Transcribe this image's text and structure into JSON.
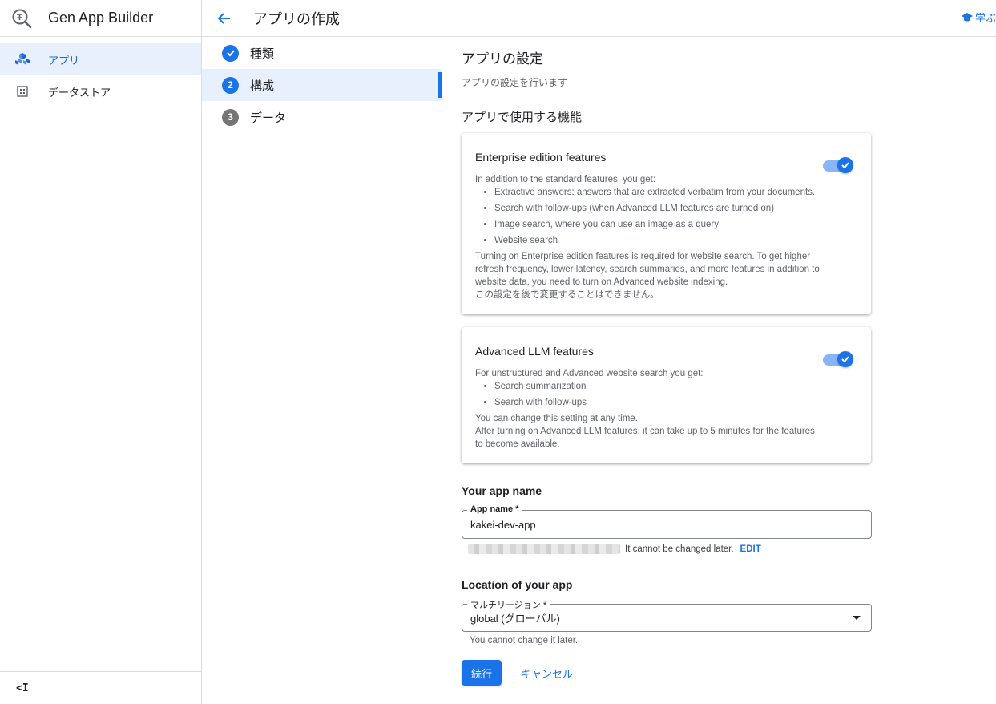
{
  "app": {
    "title": "Gen App Builder"
  },
  "sidebar": {
    "items": [
      {
        "label": "アプリ",
        "icon": "apps-cubes-icon",
        "active": true
      },
      {
        "label": "データストア",
        "icon": "datastore-grid-icon",
        "active": false
      }
    ],
    "collapse_label": "<I"
  },
  "header": {
    "title": "アプリの作成",
    "learn_label": "学ぶ"
  },
  "stepper": {
    "steps": [
      {
        "number": "",
        "label": "種類",
        "status": "done"
      },
      {
        "number": "2",
        "label": "構成",
        "status": "current"
      },
      {
        "number": "3",
        "label": "データ",
        "status": "pending"
      }
    ]
  },
  "main": {
    "section_title": "アプリの設定",
    "section_subtitle": "アプリの設定を行います",
    "features_title": "アプリで使用する機能",
    "enterprise": {
      "title": "Enterprise edition features",
      "intro": "In addition to the standard features, you get:",
      "bullets": [
        "Extractive answers: answers that are extracted verbatim from your documents.",
        "Search with follow-ups (when Advanced LLM features are turned on)",
        "Image search, where you can use an image as a query",
        "Website search"
      ],
      "note": "Turning on Enterprise edition features is required for website search. To get higher refresh frequency, lower latency, search summaries, and more features in addition to website data, you need to turn on Advanced website indexing.",
      "note_ja": "この設定を後で変更することはできません。",
      "enabled": true
    },
    "llm": {
      "title": "Advanced LLM features",
      "intro": "For unstructured and Advanced website search you get:",
      "bullets": [
        "Search summarization",
        "Search with follow-ups"
      ],
      "note1": "You can change this setting at any time.",
      "note2": "After turning on Advanced LLM features, it can take up to 5 minutes for the features to become available.",
      "enabled": true
    },
    "app_name": {
      "heading": "Your app name",
      "label": "App name *",
      "value": "kakei-dev-app",
      "hint": "It cannot be changed later.",
      "edit_label": "EDIT"
    },
    "location": {
      "heading": "Location of your app",
      "label": "マルチリージョン *",
      "value": "global (グローバル)",
      "hint": "You cannot change it later."
    },
    "actions": {
      "continue_label": "続行",
      "cancel_label": "キャンセル"
    }
  },
  "colors": {
    "accent": "#1a73e8",
    "active_bg": "#e8f0fe",
    "toggle_track": "#8ab4f8"
  }
}
